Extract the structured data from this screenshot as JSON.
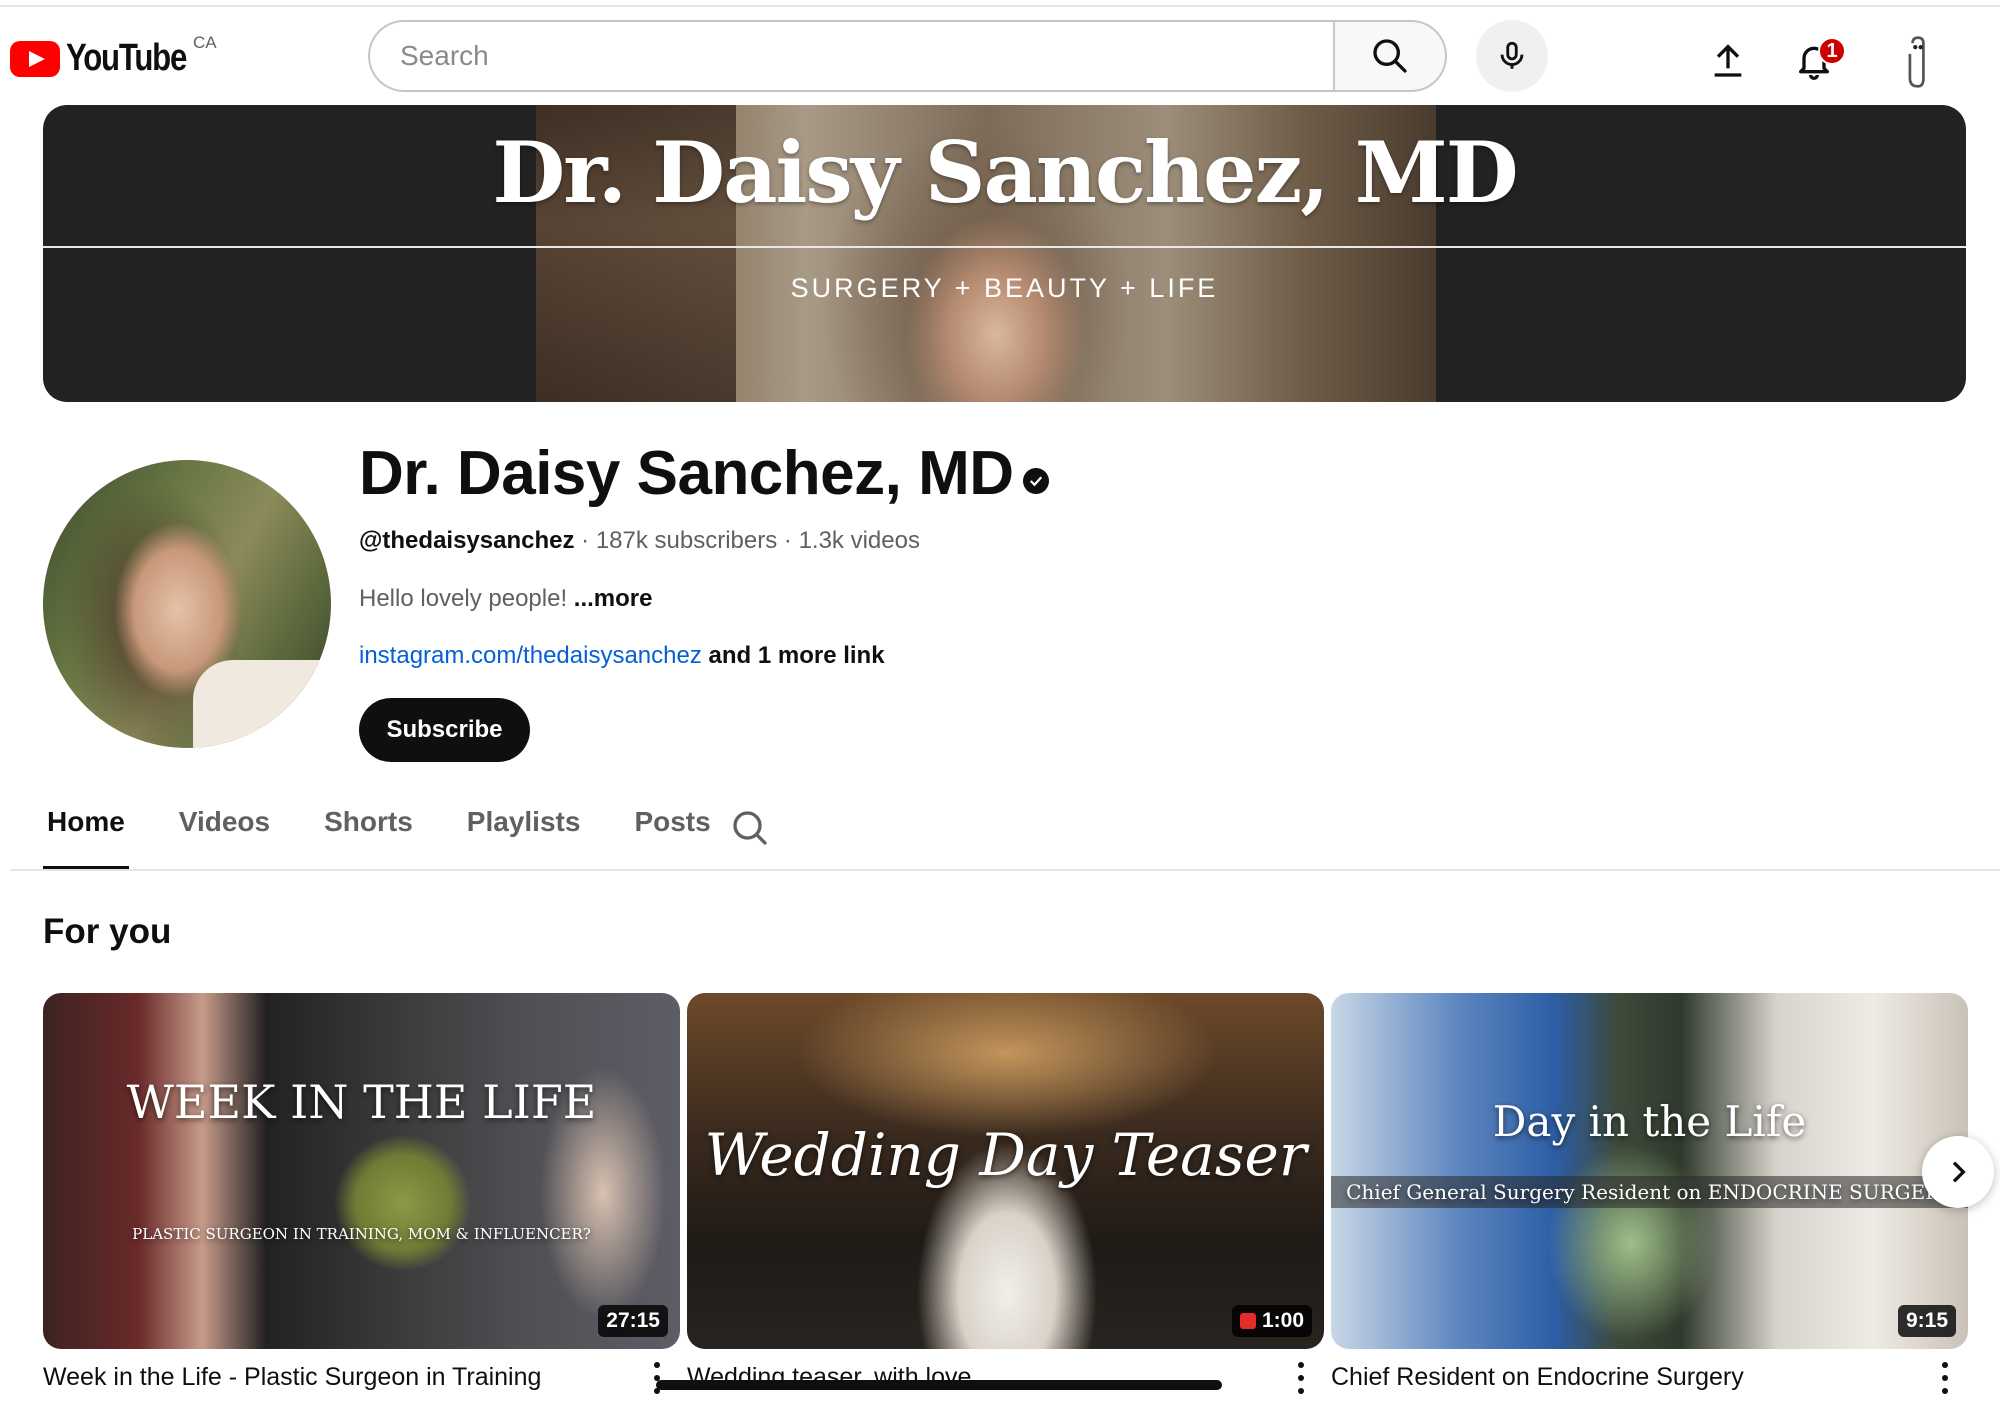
{
  "header": {
    "logo_text": "YouTube",
    "country_code": "CA",
    "search_placeholder": "Search",
    "notification_count": "1",
    "icons": [
      "search-icon",
      "mic-icon",
      "upload-icon",
      "bell-icon",
      "paperclip-avatar-icon"
    ]
  },
  "banner": {
    "title": "Dr. Daisy Sanchez, MD",
    "subtitle": "SURGERY + BEAUTY + LIFE"
  },
  "channel": {
    "name": "Dr. Daisy Sanchez, MD",
    "handle": "@thedaisysanchez",
    "subscribers": "187k subscribers",
    "videos": "1.3k videos",
    "separator": " · ",
    "description": "Hello lovely people!",
    "more": "...more",
    "link": "instagram.com/thedaisysanchez",
    "more_links": "and 1 more link",
    "subscribe_label": "Subscribe"
  },
  "tabs": [
    {
      "label": "Home",
      "active": true
    },
    {
      "label": "Videos",
      "active": false
    },
    {
      "label": "Shorts",
      "active": false
    },
    {
      "label": "Playlists",
      "active": false
    },
    {
      "label": "Posts",
      "active": false
    }
  ],
  "section": {
    "title": "For you"
  },
  "videos": [
    {
      "title": "Week in the Life - Plastic Surgeon in Training",
      "duration": "27:15",
      "thumb_title": "WEEK IN THE LIFE",
      "thumb_subtitle": "PLASTIC SURGEON IN TRAINING, MOM & INFLUENCER?"
    },
    {
      "title": "Wedding teaser, with love",
      "duration": "1:00",
      "thumb_title": "Wedding Day Teaser",
      "thumb_subtitle": ""
    },
    {
      "title": "Chief Resident on Endocrine Surgery",
      "duration": "9:15",
      "thumb_title": "Day in the Life",
      "thumb_subtitle": "Chief General Surgery Resident on ENDOCRINE SURGERY"
    }
  ],
  "colors": {
    "brand_red": "#ff0000",
    "link_blue": "#065fd4",
    "text_primary": "#0f0f0f",
    "text_secondary": "#606060",
    "banner_bg": "#222222"
  }
}
